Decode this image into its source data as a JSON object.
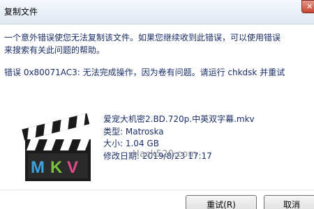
{
  "window": {
    "title": "复制文件",
    "close_glyph": "✕"
  },
  "message": {
    "line1": "一个意外错误使您无法复制该文件。如果您继续收到此错误，可以使用错误",
    "line2": "来搜索有关此问题的帮助。",
    "error_line": "错误 0x80071AC3: 无法完成操作，因为卷有问题。请运行 chkdsk 并重试"
  },
  "file": {
    "icon": "mkv-video-file-icon",
    "icon_text": "MKV",
    "name": "爱宠大机密2.BD.720p.中英双字幕.mkv",
    "type": "类型: Matroska",
    "size": "大小: 1.04 GB",
    "modified": "修改日期: 2019/8/23 17:17"
  },
  "watermark": "Hack520.com",
  "buttons": {
    "retry": "重试(R)",
    "cancel": "取消"
  },
  "colors": {
    "text": "#1a2e6a",
    "close_button": "#c84430",
    "mkv_m": "#3aa3e0",
    "mkv_k": "#7cc242",
    "mkv_v": "#e24a8b"
  }
}
